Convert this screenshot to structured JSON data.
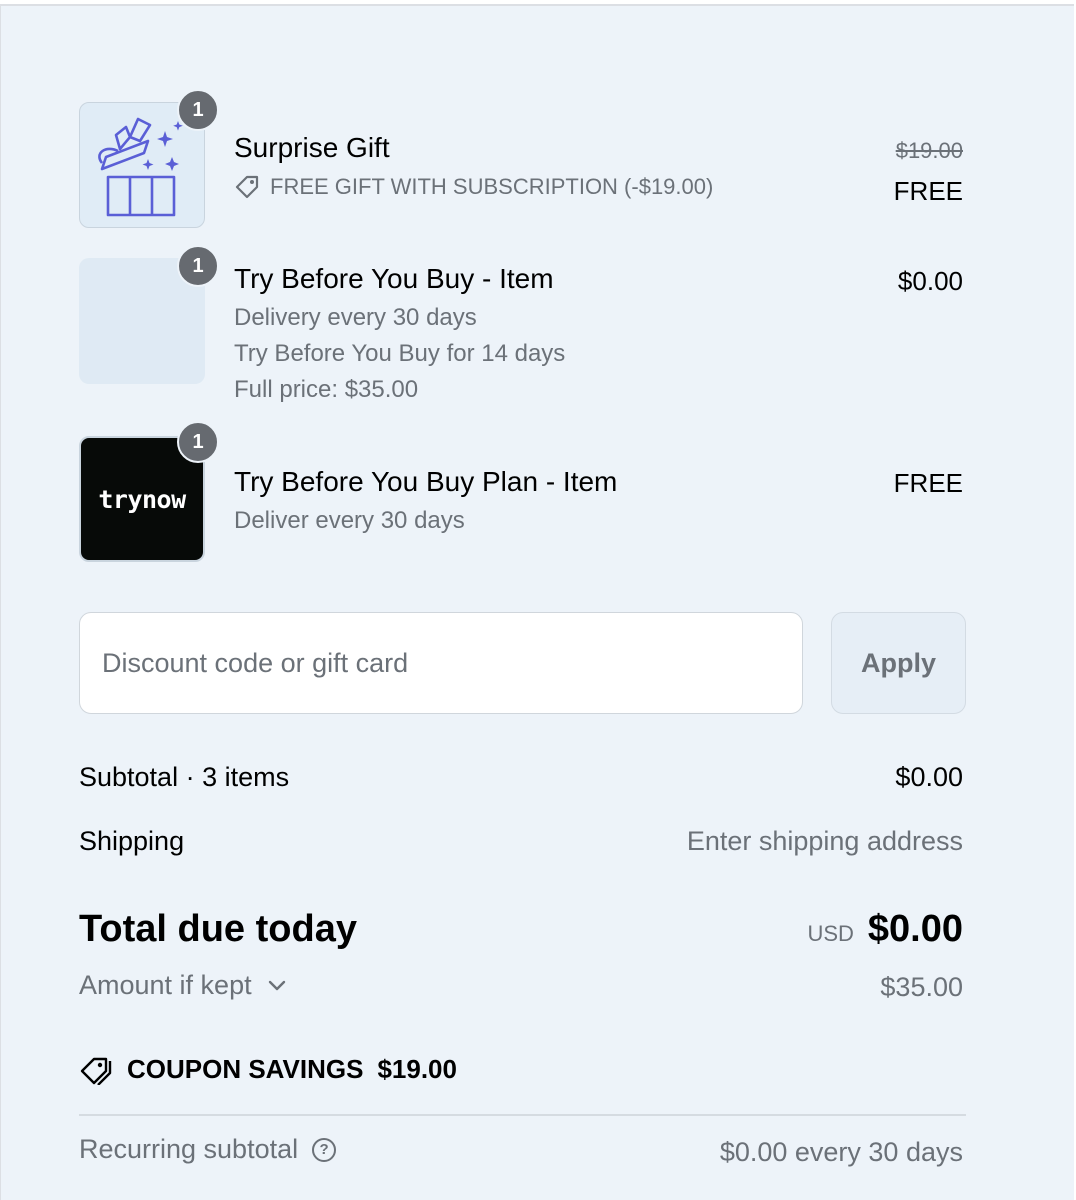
{
  "items": [
    {
      "title": "Surprise Gift",
      "quantity": "1",
      "image_icon": "gift-box-icon",
      "note_icon": "tag-icon",
      "note": "FREE GIFT WITH SUBSCRIPTION (-$19.00)",
      "original_price": "$19.00",
      "price": "FREE"
    },
    {
      "title": "Try Before You Buy - Item",
      "quantity": "1",
      "details": [
        "Delivery every 30 days",
        "Try Before You Buy for 14 days",
        "Full price: $35.00"
      ],
      "price": "$0.00"
    },
    {
      "title": "Try Before You Buy Plan - Item",
      "quantity": "1",
      "brand_logo": "trynow",
      "details": [
        "Deliver every 30 days"
      ],
      "price": "FREE"
    }
  ],
  "discount": {
    "placeholder": "Discount code or gift card",
    "value": "",
    "apply_label": "Apply"
  },
  "summary": {
    "subtotal_label": "Subtotal · 3 items",
    "subtotal_value": "$0.00",
    "shipping_label": "Shipping",
    "shipping_value": "Enter shipping address",
    "total_label": "Total due today",
    "currency": "USD",
    "total_value": "$0.00",
    "kept_label": "Amount if kept",
    "kept_value": "$35.00",
    "coupon_label": "COUPON SAVINGS",
    "coupon_value": "$19.00",
    "recurring_label": "Recurring subtotal",
    "recurring_value": "$0.00 every 30 days"
  },
  "colors": {
    "panel_bg": "#edf3f9",
    "muted_text": "#6b7178",
    "badge_bg": "#666a70",
    "gift_icon": "#5a5fd6"
  }
}
